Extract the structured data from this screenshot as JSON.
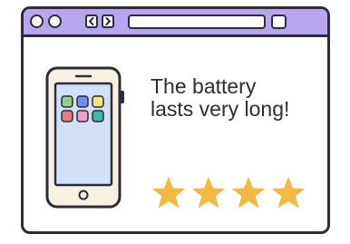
{
  "review": {
    "text": "The battery\nlasts very long!",
    "rating": 4,
    "rating_max": 4
  },
  "colors": {
    "titlebar": "#b9a6f0",
    "outline": "#2c2c3a",
    "phone_screen": "#cfe0f7",
    "phone_body": "#f7f1e3",
    "star": "#f5b942",
    "app_green": "#8fd18b",
    "app_blue": "#6f8ff0",
    "app_yellow": "#f5e27a",
    "app_red": "#f07a7a",
    "app_pink": "#f0a0c8",
    "app_teal": "#3fb6a8"
  },
  "icons": {
    "back": "chevron-left-icon",
    "forward": "chevron-right-icon",
    "star": "star-icon",
    "phone": "smartphone-icon"
  }
}
